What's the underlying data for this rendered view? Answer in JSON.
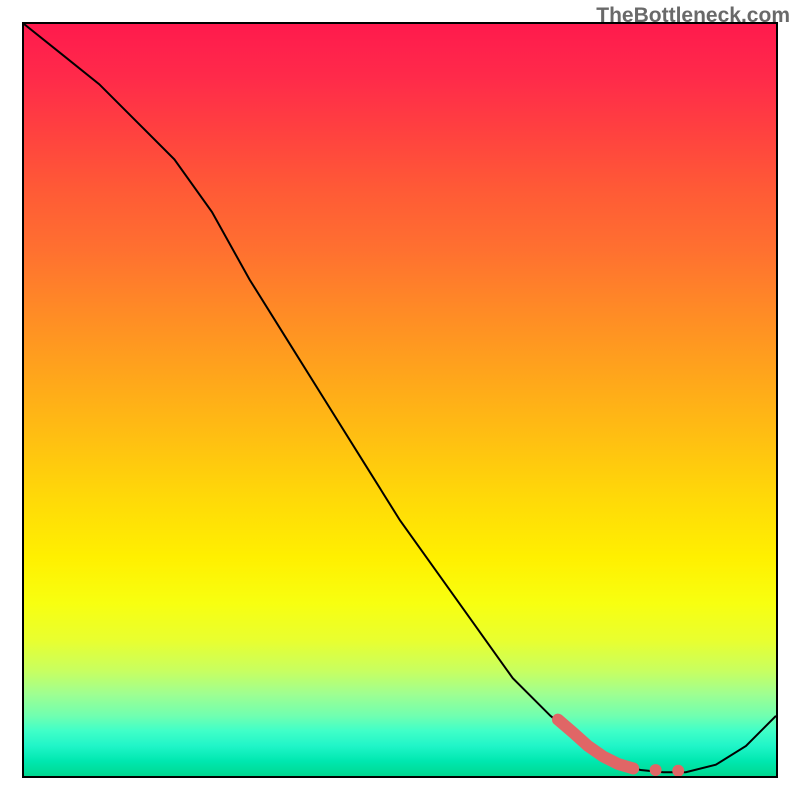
{
  "watermark": "TheBottleneck.com",
  "chart_data": {
    "type": "line",
    "title": "",
    "xlabel": "",
    "ylabel": "",
    "xlim": [
      0,
      100
    ],
    "ylim": [
      0,
      100
    ],
    "series": [
      {
        "name": "bottleneck-curve",
        "color": "#000000",
        "stroke_width": 2,
        "x": [
          0,
          5,
          10,
          15,
          20,
          25,
          30,
          35,
          40,
          45,
          50,
          55,
          60,
          65,
          70,
          75,
          80,
          82,
          85,
          88,
          92,
          96,
          100
        ],
        "y": [
          100,
          96,
          92,
          87,
          82,
          75,
          66,
          58,
          50,
          42,
          34,
          27,
          20,
          13,
          8,
          4,
          1.5,
          0.8,
          0.5,
          0.5,
          1.5,
          4,
          8
        ]
      },
      {
        "name": "highlight-segment",
        "color": "#e06666",
        "stroke_width": 12,
        "x": [
          71,
          73,
          75,
          77,
          79,
          81
        ],
        "y": [
          7.5,
          5.8,
          4.0,
          2.6,
          1.6,
          1.0
        ]
      }
    ],
    "dots": {
      "name": "highlight-dots",
      "color": "#e06666",
      "radius": 6,
      "points": [
        {
          "x": 81,
          "y": 1.0
        },
        {
          "x": 84,
          "y": 0.8
        },
        {
          "x": 87,
          "y": 0.7
        }
      ]
    },
    "gradient_stops": [
      {
        "pos": 0,
        "color": "#ff1a4d"
      },
      {
        "pos": 50,
        "color": "#ffbf12"
      },
      {
        "pos": 75,
        "color": "#fff000"
      },
      {
        "pos": 100,
        "color": "#00d890"
      }
    ]
  }
}
